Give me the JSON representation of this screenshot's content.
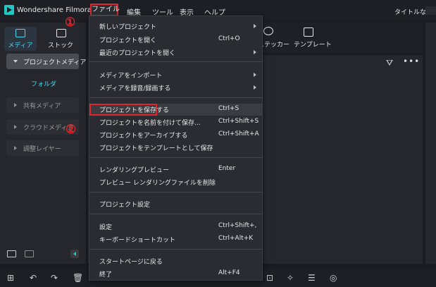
{
  "app": {
    "name": "Wondershare Filmora",
    "project_title": "タイトルなし"
  },
  "menubar": {
    "file": "ファイル",
    "edit": "編集",
    "tools": "ツール",
    "view": "表示",
    "help": "ヘルプ"
  },
  "left_panel": {
    "tabs": {
      "media": "メディア",
      "stock": "ストック"
    },
    "project_media": "プロジェクトメディア",
    "folder": "フォルダ",
    "items": [
      "共有メディア",
      "クラウドメディア",
      "調整レイヤー"
    ]
  },
  "top_tabs": {
    "sticker": "ステッカー",
    "template": "テンプレート"
  },
  "file_menu": {
    "items": [
      {
        "label": "新しいプロジェクト",
        "shortcut": ""
      },
      {
        "label": "プロジェクトを開く",
        "shortcut": "Ctrl+O"
      },
      {
        "label": "最近のプロジェクトを開く",
        "shortcut": ""
      },
      {
        "label": "メディアをインポート",
        "shortcut": ""
      },
      {
        "label": "メディアを録音/録画する",
        "shortcut": ""
      },
      {
        "label": "プロジェクトを保存する",
        "shortcut": "Ctrl+S"
      },
      {
        "label": "プロジェクトを名前を付けて保存...",
        "shortcut": "Ctrl+Shift+S"
      },
      {
        "label": "プロジェクトをアーカイブする",
        "shortcut": "Ctrl+Shift+A"
      },
      {
        "label": "プロジェクトをテンプレートとして保存",
        "shortcut": ""
      },
      {
        "label": "レンダリングプレビュー",
        "shortcut": "Enter"
      },
      {
        "label": "プレビュー レンダリングファイルを削除",
        "shortcut": ""
      },
      {
        "label": "プロジェクト設定",
        "shortcut": ""
      },
      {
        "label": "設定",
        "shortcut": "Ctrl+Shift+,"
      },
      {
        "label": "キーボードショートカット",
        "shortcut": "Ctrl+Alt+K"
      },
      {
        "label": "スタートページに戻る",
        "shortcut": ""
      },
      {
        "label": "終了",
        "shortcut": "Alt+F4"
      }
    ]
  },
  "annotations": {
    "one": "①",
    "two": "②"
  },
  "colors": {
    "accent": "#21c8c3",
    "highlight_box": "#e0262c",
    "active_text": "#4fd6f0"
  }
}
